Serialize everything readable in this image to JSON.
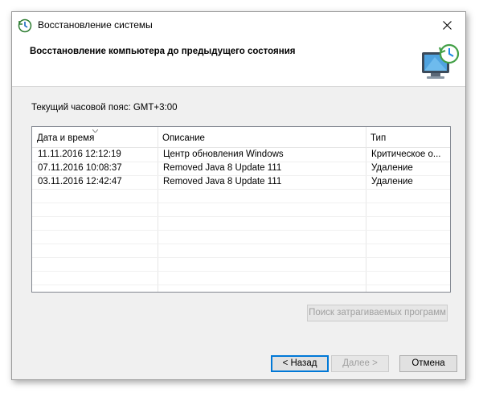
{
  "window": {
    "title": "Восстановление системы",
    "header_title": "Восстановление компьютера до предыдущего состояния"
  },
  "timezone_label": "Текущий часовой пояс: GMT+3:00",
  "table": {
    "columns": [
      "Дата и время",
      "Описание",
      "Тип"
    ],
    "rows": [
      [
        "11.11.2016 12:12:19",
        "Центр обновления Windows",
        "Критическое о..."
      ],
      [
        "07.11.2016 10:08:37",
        "Removed Java 8 Update 111",
        "Удаление"
      ],
      [
        "03.11.2016 12:42:47",
        "Removed Java 8 Update 111",
        "Удаление"
      ]
    ]
  },
  "buttons": {
    "scan": "Поиск затрагиваемых программ",
    "back": "< Назад",
    "next": "Далее >",
    "cancel": "Отмена"
  },
  "colors": {
    "accent": "#0078d7",
    "window_bg": "#f0f0f0"
  }
}
